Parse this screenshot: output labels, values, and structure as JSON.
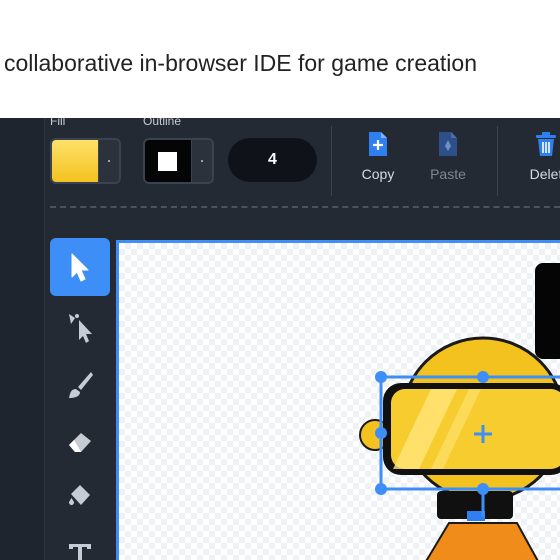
{
  "caption": "collaborative in-browser IDE for game creation",
  "toolbar": {
    "fill_label": "Fill",
    "outline_label": "Outline",
    "outline_width": "4",
    "copy_label": "Copy",
    "paste_label": "Paste",
    "delete_label": "Delet"
  },
  "colors": {
    "fill": "#f7c82b",
    "outline": "#000000",
    "accent": "#3e8ef7",
    "editor_bg": "#232a34"
  },
  "tools": [
    {
      "icon": "arrow-select-icon",
      "active": true
    },
    {
      "icon": "reshape-icon",
      "active": false
    },
    {
      "icon": "brush-icon",
      "active": false
    },
    {
      "icon": "eraser-icon",
      "active": false
    },
    {
      "icon": "fill-bucket-icon",
      "active": false
    },
    {
      "icon": "text-icon",
      "active": false
    }
  ]
}
